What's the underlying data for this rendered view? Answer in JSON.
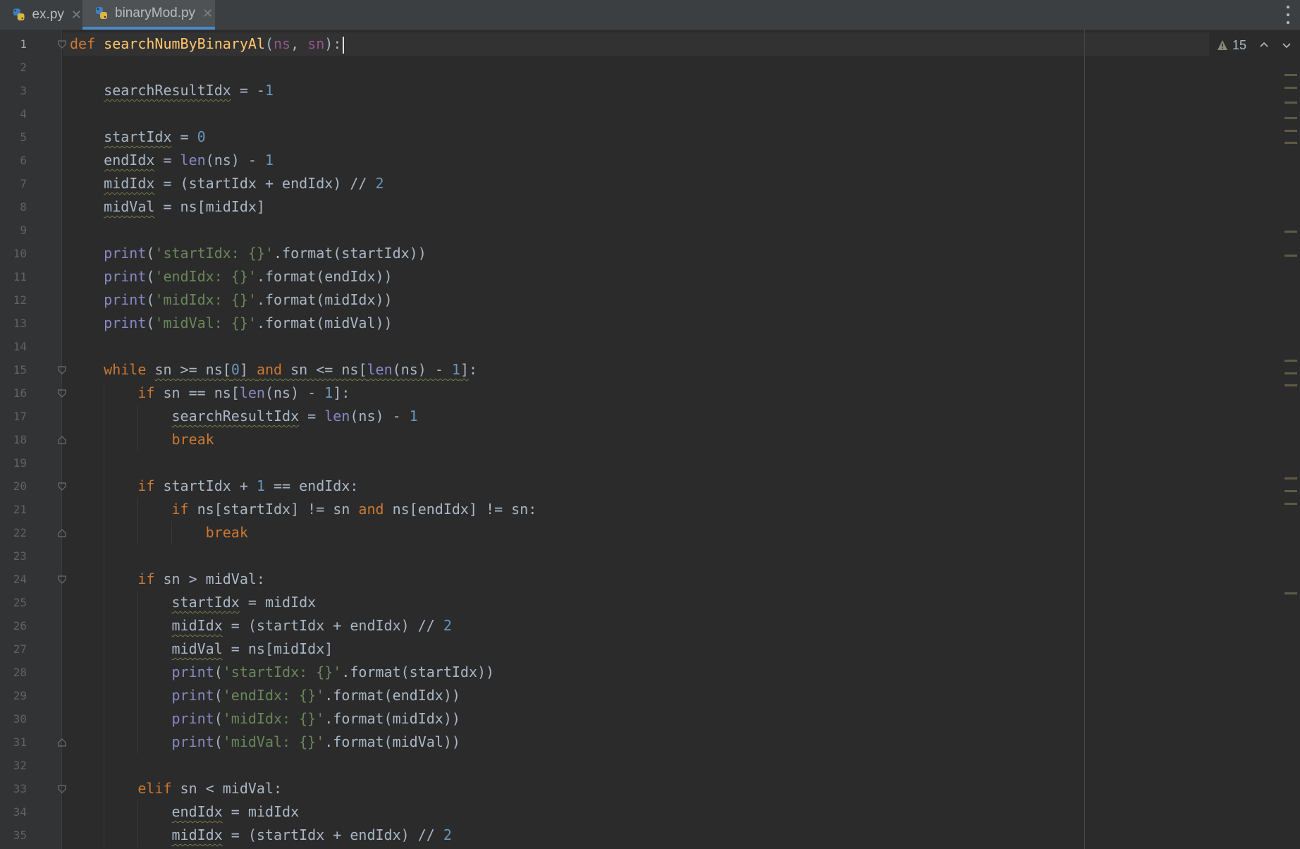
{
  "tabs": [
    {
      "label": "ex.py",
      "active": false
    },
    {
      "label": "binaryMod.py",
      "active": true
    }
  ],
  "inspection": {
    "count": "15"
  },
  "colors": {
    "keyword": "#cc7832",
    "function": "#ffc66d",
    "builtin": "#8888c6",
    "string": "#6a8759",
    "number": "#6897bb",
    "text": "#a9b7c6"
  },
  "code": [
    [
      [
        "k",
        "def"
      ],
      [
        "t",
        " "
      ],
      [
        "fn",
        "searchNumByBinaryAl"
      ],
      [
        "t",
        "("
      ],
      [
        "p",
        "ns"
      ],
      [
        "t",
        ", "
      ],
      [
        "p",
        "sn"
      ],
      [
        "t",
        "):"
      ]
    ],
    [],
    [
      [
        "t",
        "    "
      ],
      [
        "w",
        "searchResultIdx"
      ],
      [
        "t",
        " = -"
      ],
      [
        "n",
        "1"
      ]
    ],
    [],
    [
      [
        "t",
        "    "
      ],
      [
        "w",
        "startIdx"
      ],
      [
        "t",
        " = "
      ],
      [
        "n",
        "0"
      ]
    ],
    [
      [
        "t",
        "    "
      ],
      [
        "w",
        "endIdx"
      ],
      [
        "t",
        " = "
      ],
      [
        "b",
        "len"
      ],
      [
        "t",
        "(ns) - "
      ],
      [
        "n",
        "1"
      ]
    ],
    [
      [
        "t",
        "    "
      ],
      [
        "w",
        "midIdx"
      ],
      [
        "t",
        " = (startIdx + endIdx) // "
      ],
      [
        "n",
        "2"
      ]
    ],
    [
      [
        "t",
        "    "
      ],
      [
        "w",
        "midVal"
      ],
      [
        "t",
        " = ns[midIdx]"
      ]
    ],
    [],
    [
      [
        "t",
        "    "
      ],
      [
        "b",
        "print"
      ],
      [
        "t",
        "("
      ],
      [
        "s",
        "'startIdx: {}'"
      ],
      [
        "t",
        ".format(startIdx))"
      ]
    ],
    [
      [
        "t",
        "    "
      ],
      [
        "b",
        "print"
      ],
      [
        "t",
        "("
      ],
      [
        "s",
        "'endIdx: {}'"
      ],
      [
        "t",
        ".format(endIdx))"
      ]
    ],
    [
      [
        "t",
        "    "
      ],
      [
        "b",
        "print"
      ],
      [
        "t",
        "("
      ],
      [
        "s",
        "'midIdx: {}'"
      ],
      [
        "t",
        ".format(midIdx))"
      ]
    ],
    [
      [
        "t",
        "    "
      ],
      [
        "b",
        "print"
      ],
      [
        "t",
        "("
      ],
      [
        "s",
        "'midVal: {}'"
      ],
      [
        "t",
        ".format(midVal))"
      ]
    ],
    [],
    [
      [
        "t",
        "    "
      ],
      [
        "k",
        "while"
      ],
      [
        "t",
        " "
      ],
      [
        "w",
        "sn >= ns["
      ],
      [
        "wn",
        "0"
      ],
      [
        "w",
        "] "
      ],
      [
        "wk",
        "and"
      ],
      [
        "w",
        " sn <= ns["
      ],
      [
        "wb",
        "len"
      ],
      [
        "w",
        "(ns) - "
      ],
      [
        "wn",
        "1"
      ],
      [
        "w",
        "]"
      ],
      [
        "t",
        ":"
      ]
    ],
    [
      [
        "t",
        "        "
      ],
      [
        "k",
        "if"
      ],
      [
        "t",
        " sn == ns["
      ],
      [
        "b",
        "len"
      ],
      [
        "t",
        "(ns) - "
      ],
      [
        "n",
        "1"
      ],
      [
        "t",
        "]:"
      ]
    ],
    [
      [
        "t",
        "            "
      ],
      [
        "w",
        "searchResultIdx"
      ],
      [
        "t",
        " = "
      ],
      [
        "b",
        "len"
      ],
      [
        "t",
        "(ns) - "
      ],
      [
        "n",
        "1"
      ]
    ],
    [
      [
        "t",
        "            "
      ],
      [
        "k",
        "break"
      ]
    ],
    [],
    [
      [
        "t",
        "        "
      ],
      [
        "k",
        "if"
      ],
      [
        "t",
        " startIdx + "
      ],
      [
        "n",
        "1"
      ],
      [
        "t",
        " == endIdx:"
      ]
    ],
    [
      [
        "t",
        "            "
      ],
      [
        "k",
        "if"
      ],
      [
        "t",
        " ns[startIdx] != sn "
      ],
      [
        "k",
        "and"
      ],
      [
        "t",
        " ns[endIdx] != sn:"
      ]
    ],
    [
      [
        "t",
        "                "
      ],
      [
        "k",
        "break"
      ]
    ],
    [],
    [
      [
        "t",
        "        "
      ],
      [
        "k",
        "if"
      ],
      [
        "t",
        " sn > midVal:"
      ]
    ],
    [
      [
        "t",
        "            "
      ],
      [
        "w",
        "startIdx"
      ],
      [
        "t",
        " = midIdx"
      ]
    ],
    [
      [
        "t",
        "            "
      ],
      [
        "w",
        "midIdx"
      ],
      [
        "t",
        " = (startIdx + endIdx) // "
      ],
      [
        "n",
        "2"
      ]
    ],
    [
      [
        "t",
        "            "
      ],
      [
        "w",
        "midVal"
      ],
      [
        "t",
        " = ns[midIdx]"
      ]
    ],
    [
      [
        "t",
        "            "
      ],
      [
        "b",
        "print"
      ],
      [
        "t",
        "("
      ],
      [
        "s",
        "'startIdx: {}'"
      ],
      [
        "t",
        ".format(startIdx))"
      ]
    ],
    [
      [
        "t",
        "            "
      ],
      [
        "b",
        "print"
      ],
      [
        "t",
        "("
      ],
      [
        "s",
        "'endIdx: {}'"
      ],
      [
        "t",
        ".format(endIdx))"
      ]
    ],
    [
      [
        "t",
        "            "
      ],
      [
        "b",
        "print"
      ],
      [
        "t",
        "("
      ],
      [
        "s",
        "'midIdx: {}'"
      ],
      [
        "t",
        ".format(midIdx))"
      ]
    ],
    [
      [
        "t",
        "            "
      ],
      [
        "b",
        "print"
      ],
      [
        "t",
        "("
      ],
      [
        "s",
        "'midVal: {}'"
      ],
      [
        "t",
        ".format(midVal))"
      ]
    ],
    [],
    [
      [
        "t",
        "        "
      ],
      [
        "k",
        "elif"
      ],
      [
        "t",
        " sn < midVal:"
      ]
    ],
    [
      [
        "t",
        "            "
      ],
      [
        "w",
        "endIdx"
      ],
      [
        "t",
        " = midIdx"
      ]
    ],
    [
      [
        "t",
        "            "
      ],
      [
        "w",
        "midIdx"
      ],
      [
        "t",
        " = (startIdx + endIdx) // "
      ],
      [
        "n",
        "2"
      ]
    ]
  ]
}
